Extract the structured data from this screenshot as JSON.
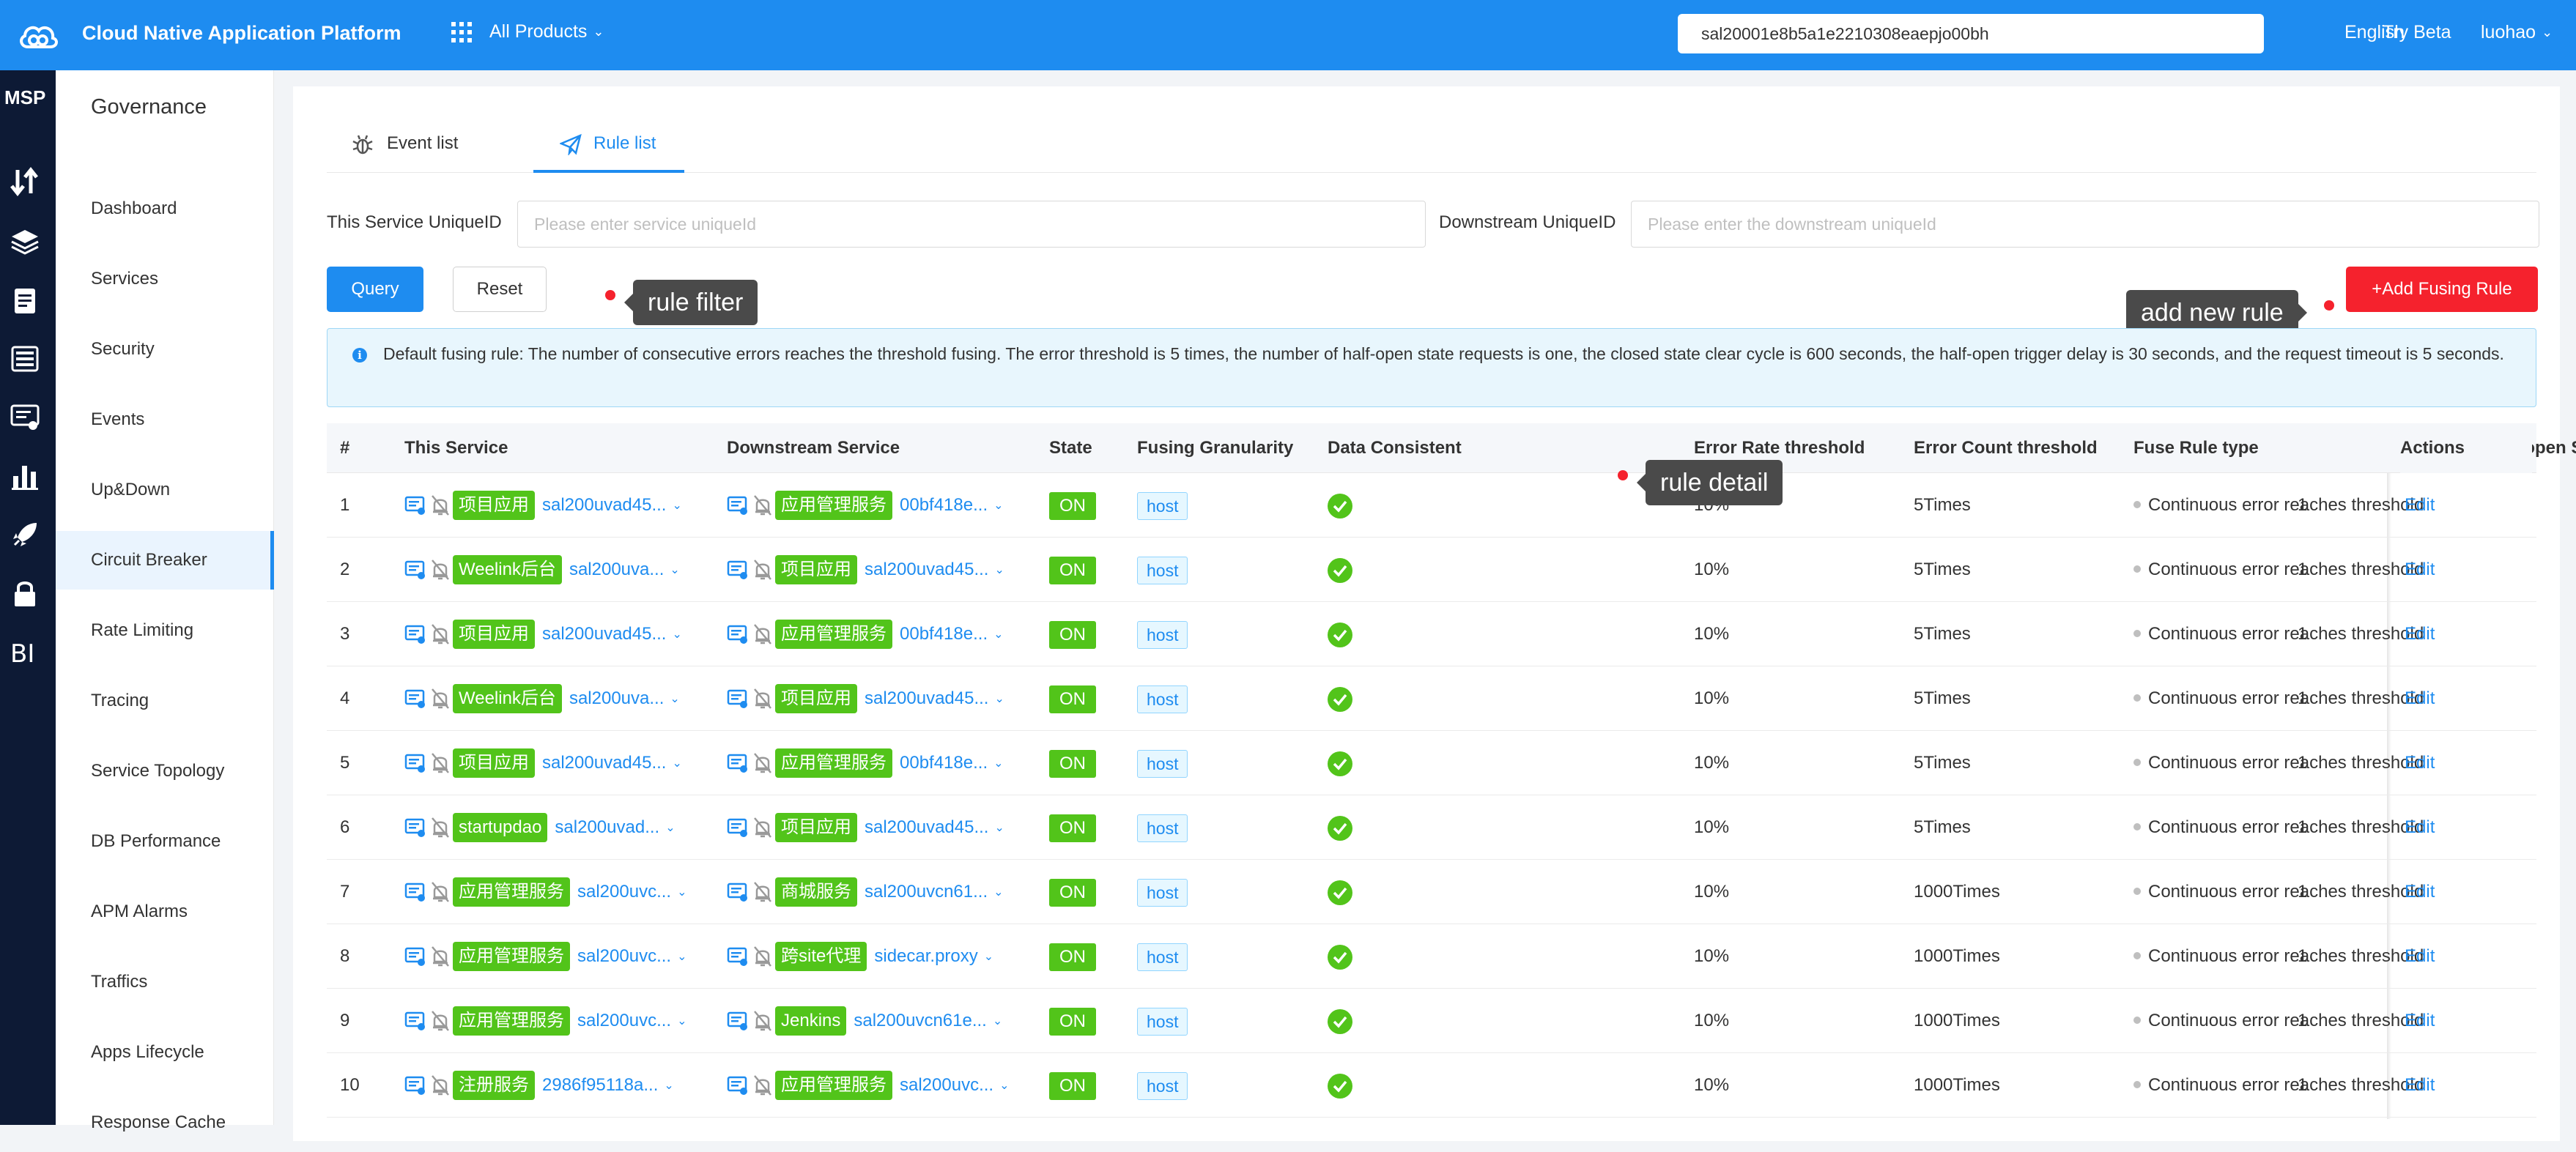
{
  "header": {
    "app_title": "Cloud Native Application Platform",
    "products_label": "All Products",
    "search_value": "sal20001e8b5a1e2210308eaepjo00bh",
    "language": "English",
    "try_beta": "Try Beta",
    "user": "luohao",
    "brand_color": "#1e8cf0"
  },
  "rail": {
    "brand": "MSP",
    "icons": [
      "upload-download-icon",
      "layers-icon",
      "clipboard-icon",
      "server-icon",
      "monitor-icon",
      "bar-chart-icon",
      "rocket-icon",
      "lock-icon",
      "bi-icon"
    ]
  },
  "nav": {
    "title": "Governance",
    "items": [
      {
        "label": "Dashboard"
      },
      {
        "label": "Services"
      },
      {
        "label": "Security"
      },
      {
        "label": "Events"
      },
      {
        "label": "Up&Down"
      },
      {
        "label": "Circuit Breaker"
      },
      {
        "label": "Rate Limiting"
      },
      {
        "label": "Tracing"
      },
      {
        "label": "Service Topology"
      },
      {
        "label": "DB Performance"
      },
      {
        "label": "APM Alarms"
      },
      {
        "label": "Traffics"
      },
      {
        "label": "Apps Lifecycle"
      },
      {
        "label": "Response Cache"
      }
    ],
    "active_item": "Circuit Breaker"
  },
  "tabs": [
    {
      "label": "Event list",
      "icon": "bug-icon"
    },
    {
      "label": "Rule list",
      "icon": "send-icon"
    }
  ],
  "filters": {
    "service_label": "This Service UniqueID",
    "service_placeholder": "Please enter service uniqueId",
    "downstream_label": "Downstream UniqueID",
    "downstream_placeholder": "Please enter the downstream uniqueId",
    "query_label": "Query",
    "reset_label": "Reset",
    "add_label": "+Add Fusing Rule"
  },
  "tooltips": {
    "filter": "rule filter",
    "add": "add new rule",
    "detail": "rule detail"
  },
  "alert_text": "Default fusing rule: The number of consecutive errors reaches the threshold fusing. The error threshold is 5 times, the number of half-open state requests is one, the closed state clear cycle is 600 seconds, the half-open trigger delay is 30 seconds, and the request timeout is 5 seconds.",
  "table": {
    "columns": [
      "#",
      "This Service",
      "Downstream Service",
      "State",
      "Fusing Granularity",
      "Data Consistent",
      "Error Rate threshold",
      "Error Count threshold",
      "Fuse Rule type",
      "Half-open S",
      "Actions"
    ],
    "rows": [
      {
        "no": "1",
        "svc_tag": "项目应用",
        "svc_id": "sal200uvad45...",
        "ds_tag": "应用管理服务",
        "ds_id": "00bf418e...",
        "state": "ON",
        "granularity": "host",
        "rate": "10%",
        "count": "5Times",
        "type": "Continuous error reaches threshold",
        "half": "1",
        "action": "Edit"
      },
      {
        "no": "2",
        "svc_tag": "Weelink后台",
        "svc_id": "sal200uva...",
        "ds_tag": "项目应用",
        "ds_id": "sal200uvad45...",
        "state": "ON",
        "granularity": "host",
        "rate": "10%",
        "count": "5Times",
        "type": "Continuous error reaches threshold",
        "half": "1",
        "action": "Edit"
      },
      {
        "no": "3",
        "svc_tag": "项目应用",
        "svc_id": "sal200uvad45...",
        "ds_tag": "应用管理服务",
        "ds_id": "00bf418e...",
        "state": "ON",
        "granularity": "host",
        "rate": "10%",
        "count": "5Times",
        "type": "Continuous error reaches threshold",
        "half": "1",
        "action": "Edit"
      },
      {
        "no": "4",
        "svc_tag": "Weelink后台",
        "svc_id": "sal200uva...",
        "ds_tag": "项目应用",
        "ds_id": "sal200uvad45...",
        "state": "ON",
        "granularity": "host",
        "rate": "10%",
        "count": "5Times",
        "type": "Continuous error reaches threshold",
        "half": "1",
        "action": "Edit"
      },
      {
        "no": "5",
        "svc_tag": "项目应用",
        "svc_id": "sal200uvad45...",
        "ds_tag": "应用管理服务",
        "ds_id": "00bf418e...",
        "state": "ON",
        "granularity": "host",
        "rate": "10%",
        "count": "5Times",
        "type": "Continuous error reaches threshold",
        "half": "1",
        "action": "Edit"
      },
      {
        "no": "6",
        "svc_tag": "startupdao",
        "svc_id": "sal200uvad...",
        "ds_tag": "项目应用",
        "ds_id": "sal200uvad45...",
        "state": "ON",
        "granularity": "host",
        "rate": "10%",
        "count": "5Times",
        "type": "Continuous error reaches threshold",
        "half": "1",
        "action": "Edit"
      },
      {
        "no": "7",
        "svc_tag": "应用管理服务",
        "svc_id": "sal200uvc...",
        "ds_tag": "商城服务",
        "ds_id": "sal200uvcn61...",
        "state": "ON",
        "granularity": "host",
        "rate": "10%",
        "count": "1000Times",
        "type": "Continuous error reaches threshold",
        "half": "1",
        "action": "Edit"
      },
      {
        "no": "8",
        "svc_tag": "应用管理服务",
        "svc_id": "sal200uvc...",
        "ds_tag": "跨site代理",
        "ds_id": "sidecar.proxy",
        "state": "ON",
        "granularity": "host",
        "rate": "10%",
        "count": "1000Times",
        "type": "Continuous error reaches threshold",
        "half": "1",
        "action": "Edit"
      },
      {
        "no": "9",
        "svc_tag": "应用管理服务",
        "svc_id": "sal200uvc...",
        "ds_tag": "Jenkins",
        "ds_id": "sal200uvcn61e...",
        "state": "ON",
        "granularity": "host",
        "rate": "10%",
        "count": "1000Times",
        "type": "Continuous error reaches threshold",
        "half": "1",
        "action": "Edit"
      },
      {
        "no": "10",
        "svc_tag": "注册服务",
        "svc_id": "2986f95118a...",
        "ds_tag": "应用管理服务",
        "ds_id": "sal200uvc...",
        "state": "ON",
        "granularity": "host",
        "rate": "10%",
        "count": "1000Times",
        "type": "Continuous error reaches threshold",
        "half": "1",
        "action": "Edit"
      }
    ]
  }
}
